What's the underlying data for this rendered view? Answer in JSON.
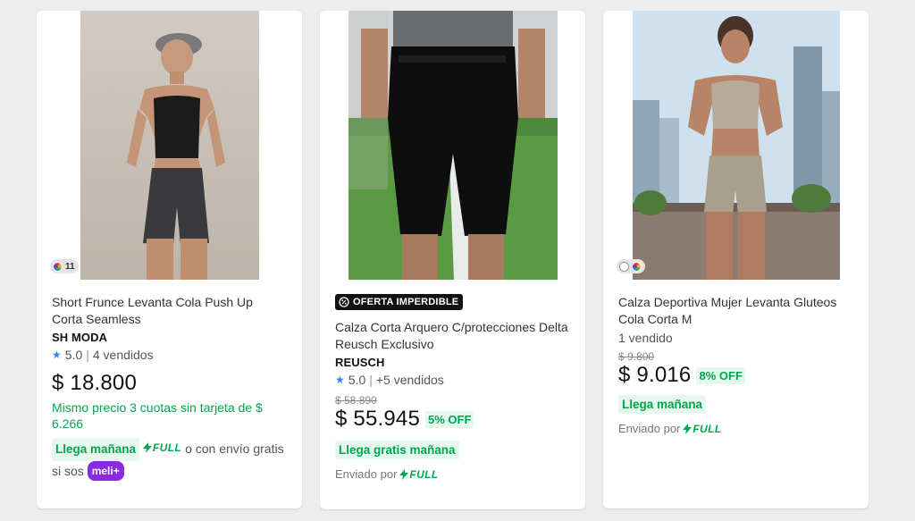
{
  "products": [
    {
      "title": "Short Frunce Levanta Cola Push Up Corta Seamless",
      "brand": "SH MODA",
      "rating": "5.0",
      "sold": "4 vendidos",
      "price": "$ 18.800",
      "installments": "Mismo precio 3 cuotas sin tarjeta de $ 6.266",
      "shipping": "Llega mañana",
      "shipping_extra": "o con envío gratis si sos",
      "full_label": "FULL",
      "meli_label": "meli+",
      "colors_count": "11",
      "image_icon": "woman-gray-shorts-photo"
    },
    {
      "badge": "OFERTA IMPERDIBLE",
      "title": "Calza Corta Arquero C/protecciones Delta Reusch Exclusivo",
      "brand": "REUSCH",
      "rating": "5.0",
      "sold": "+5 vendidos",
      "old_price": "$ 58.890",
      "price": "$ 55.945",
      "discount": "5% OFF",
      "shipping": "Llega gratis mañana",
      "sent_by": "Enviado por",
      "full_label": "FULL",
      "image_icon": "goalkeeper-shorts-photo"
    },
    {
      "title": "Calza Deportiva Mujer Levanta Gluteos Cola Corta M",
      "sold": "1 vendido",
      "old_price": "$ 9.800",
      "price": "$ 9.016",
      "discount": "8% OFF",
      "shipping": "Llega mañana",
      "sent_by": "Enviado por",
      "full_label": "FULL",
      "image_icon": "woman-beige-set-photo"
    }
  ],
  "colors": {
    "accent_green": "#00a650",
    "green_bg": "#e6f7ee",
    "star_blue": "#3483fa",
    "meli_purple": "#8a2be2"
  }
}
